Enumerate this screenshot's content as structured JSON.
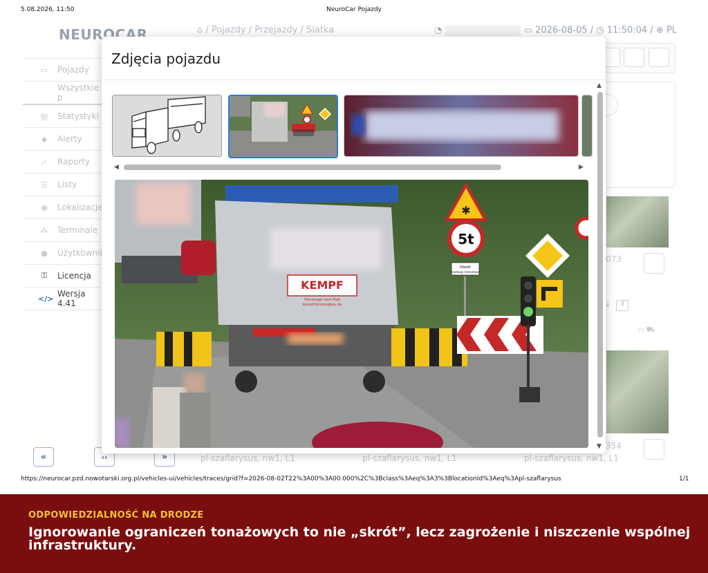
{
  "print": {
    "date": "5.08.2026, 11:50",
    "title": "NeuroCar Pojazdy",
    "url": "https://neurocar.pzd.nowotarski.org.pl/vehicles-ui/vehicles/traces/grid?f=2026-08-02T22%3A00%3A00.000%2C%3Bclass%3Aeq%3A3%3BlocationId%3Aeq%3Apl-szaflarysus",
    "page": "1/1"
  },
  "brand": "NEUROCAR",
  "breadcrumb": {
    "home_icon": "home-icon",
    "items": [
      "Pojazdy",
      "Przejazdy",
      "Siatka"
    ],
    "sep": "/"
  },
  "topbar": {
    "date": "2026-08-05",
    "time": "11:50:04",
    "lang": "PL"
  },
  "sidebar": {
    "items": [
      {
        "label": "Pojazdy",
        "icon": "car-icon"
      },
      {
        "label": "Wszystkie p",
        "icon": ""
      },
      {
        "label": "Statystyki",
        "icon": "chart-icon"
      },
      {
        "label": "Alerty",
        "icon": "bell-icon"
      },
      {
        "label": "Raporty",
        "icon": "report-icon"
      },
      {
        "label": "Listy",
        "icon": "list-icon"
      },
      {
        "label": "Lokalizacje",
        "icon": "pin-icon"
      },
      {
        "label": "Terminale",
        "icon": "network-icon"
      },
      {
        "label": "Użytkownik",
        "icon": "user-icon"
      },
      {
        "label": "Licencja",
        "icon": "key-icon"
      },
      {
        "label": "Wersja 4.41",
        "icon": "code-icon"
      }
    ]
  },
  "cards": {
    "label1": "pl-szaflarysus, nw1, L1",
    "label2": "pl-szaflarysus, nw1, L1",
    "label3": "pl-szaflarysus, nw1, L1",
    "id1": "073",
    "id2": "354",
    "count": "3"
  },
  "pager": {
    "first": "«",
    "mid": "‹›",
    "last": "»"
  },
  "modal": {
    "title": "Zdjęcia pojazdu"
  },
  "photo": {
    "sign_limit": "5t",
    "plate_text": "KEMPF",
    "plate_sub": "Fahrzeuge nach Maß",
    "plate_url": "kempf-fahrzeugbau.de",
    "plaque1": "Obiekt",
    "plaque2": "mostowy remontowy"
  },
  "banner": {
    "heading": "ODPOWIEDZIALNOŚĆ NA DRODZE",
    "body": "Ignorowanie ograniczeń tonażowych to nie „skrót”, lecz zagrożenie i niszczenie wspólnej infrastruktury."
  }
}
